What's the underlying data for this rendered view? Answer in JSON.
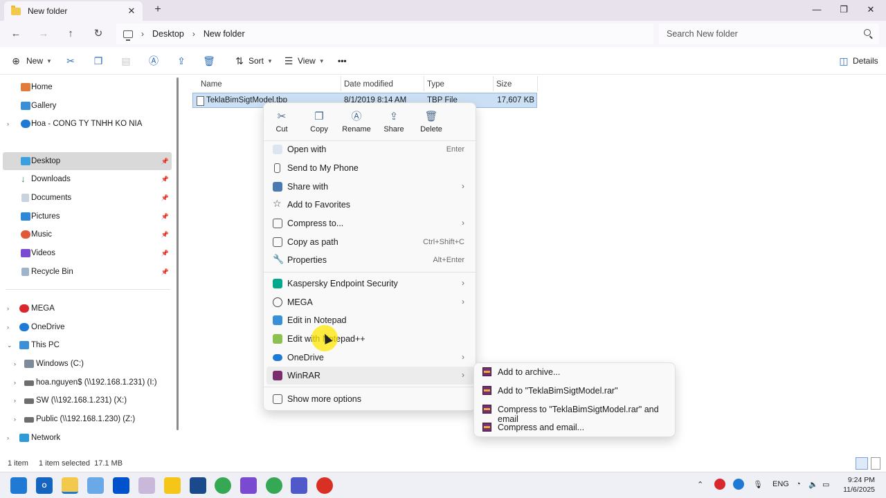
{
  "tab": {
    "title": "New folder",
    "close": "✕",
    "new_tab": "+"
  },
  "window_controls": {
    "minimize": "—",
    "maximize": "❐",
    "close": "✕"
  },
  "nav": {
    "back": "←",
    "forward": "→",
    "up": "↑",
    "refresh": "↻"
  },
  "breadcrumb": [
    "Desktop",
    "New folder"
  ],
  "search": {
    "placeholder": "Search New folder"
  },
  "toolbar": {
    "new_label": "New",
    "sort_label": "Sort",
    "view_label": "View",
    "more_label": "•••",
    "details_label": "Details"
  },
  "sidebar": {
    "home": "Home",
    "gallery": "Gallery",
    "onedrive_org": "Hoa - CONG TY TNHH KO NIA",
    "desktop": "Desktop",
    "downloads": "Downloads",
    "documents": "Documents",
    "pictures": "Pictures",
    "music": "Music",
    "videos": "Videos",
    "recycle": "Recycle Bin",
    "mega": "MEGA",
    "onedrive": "OneDrive",
    "thispc": "This PC",
    "windows_c": "Windows (C:)",
    "drive_i": "hoa.nguyen$ (\\\\192.168.1.231) (I:)",
    "drive_x": "SW (\\\\192.168.1.231) (X:)",
    "drive_z": "Public (\\\\192.168.1.230) (Z:)",
    "network": "Network"
  },
  "columns": {
    "name": "Name",
    "date": "Date modified",
    "type": "Type",
    "size": "Size"
  },
  "file": {
    "name": "TeklaBimSigtModel.tbp",
    "date": "8/1/2019 8:14 AM",
    "type": "TBP File",
    "size": "17,607 KB"
  },
  "status": {
    "count": "1 item",
    "selected": "1 item selected  17.1 MB"
  },
  "context_menu": {
    "quick": {
      "cut": "Cut",
      "copy": "Copy",
      "rename": "Rename",
      "share": "Share",
      "delete": "Delete"
    },
    "open_with": "Open with",
    "open_with_shortcut": "Enter",
    "send_phone": "Send to My Phone",
    "share_with": "Share with",
    "favorites": "Add to Favorites",
    "compress": "Compress to...",
    "copy_path": "Copy as path",
    "copy_path_shortcut": "Ctrl+Shift+C",
    "properties": "Properties",
    "properties_shortcut": "Alt+Enter",
    "kaspersky": "Kaspersky Endpoint Security",
    "mega": "MEGA",
    "notepad": "Edit in Notepad",
    "notepadpp": "Edit with Notepad++",
    "onedrive": "OneDrive",
    "winrar": "WinRAR",
    "more": "Show more options"
  },
  "winrar_submenu": {
    "add_archive": "Add to archive...",
    "add_rar": "Add to \"TeklaBimSigtModel.rar\"",
    "compress_email": "Compress to \"TeklaBimSigtModel.rar\" and email",
    "compress_and_email": "Compress and email..."
  },
  "taskbar": {
    "lang": "ENG",
    "time": "9:24 PM",
    "date": "11/6/2025"
  },
  "colors": {
    "accent": "#2a6bb8",
    "selection": "#cce0f5",
    "winrar": "#7a2d6c"
  }
}
